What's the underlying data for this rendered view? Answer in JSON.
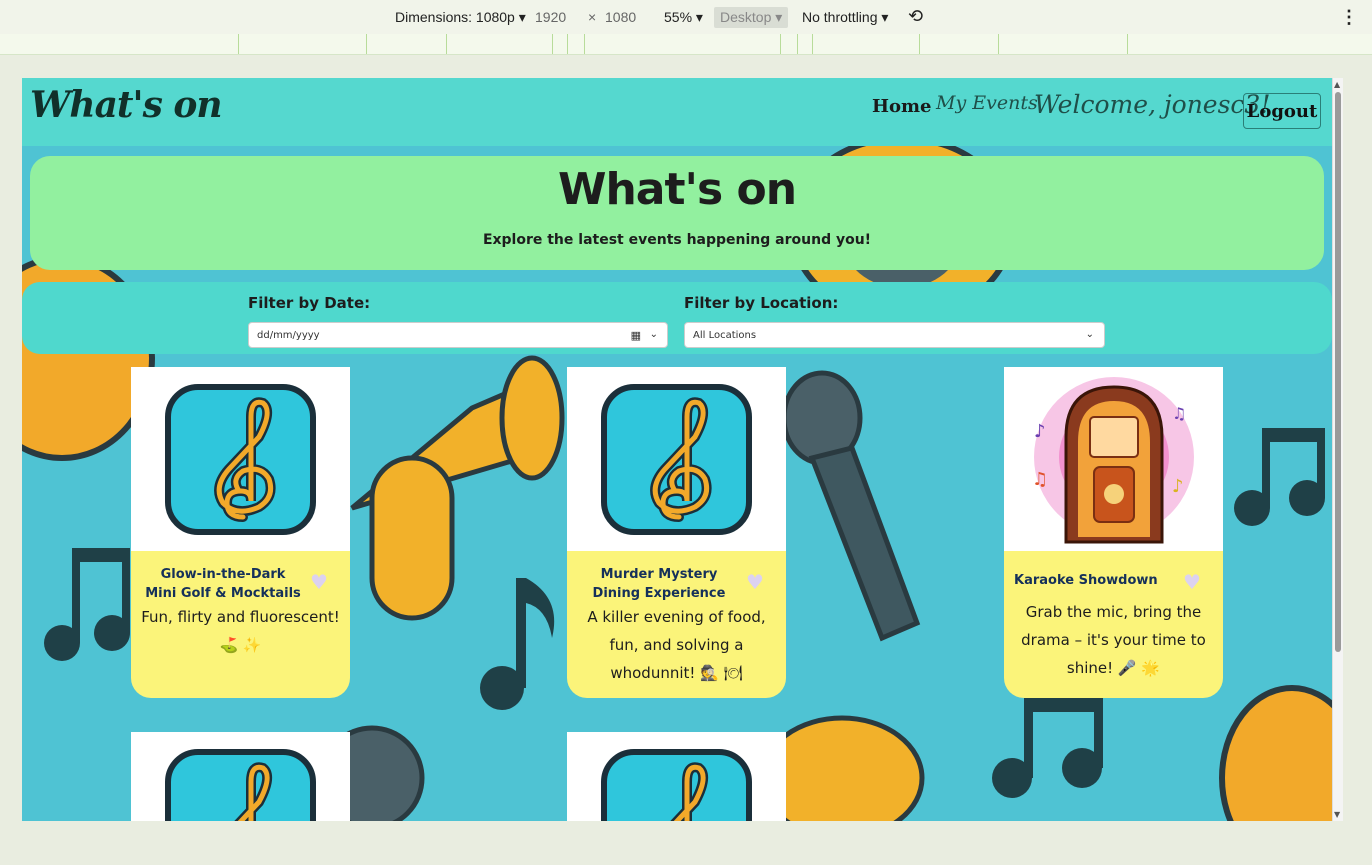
{
  "devtools": {
    "dimensions_label": "Dimensions: 1080p",
    "width": "1920",
    "times": "×",
    "height": "1080",
    "zoom": "55%",
    "device_mode": "Desktop",
    "throttling": "No throttling"
  },
  "nav": {
    "brand": "What's on",
    "home": "Home",
    "my_events": "My Events",
    "welcome": "Welcome, jonesc3!",
    "logout": "Logout"
  },
  "hero": {
    "title": "What's on",
    "subtitle": "Explore the latest events happening around you!"
  },
  "filters": {
    "date_label": "Filter by Date:",
    "date_placeholder": "dd/mm/yyyy",
    "location_label": "Filter by Location:",
    "location_selected": "All Locations"
  },
  "events": [
    {
      "title": "Glow-in-the-Dark Mini Golf & Mocktails",
      "description": "Fun, flirty and fluorescent! ⛳ ✨",
      "image": "treble-clef-icon"
    },
    {
      "title": "Murder Mystery Dining Experience",
      "description": "A killer evening of food, fun, and solving a whodunnit! 🕵 🍽",
      "image": "treble-clef-icon"
    },
    {
      "title": "Karaoke Showdown",
      "description": "Grab the mic, bring the drama – it's your time to shine! 🎤 🌟",
      "image": "jukebox-image"
    }
  ],
  "colors": {
    "navbar": "#55d8cf",
    "hero": "#92f09f",
    "card_body": "#fbf47a",
    "page_background": "#4fc3d3"
  }
}
